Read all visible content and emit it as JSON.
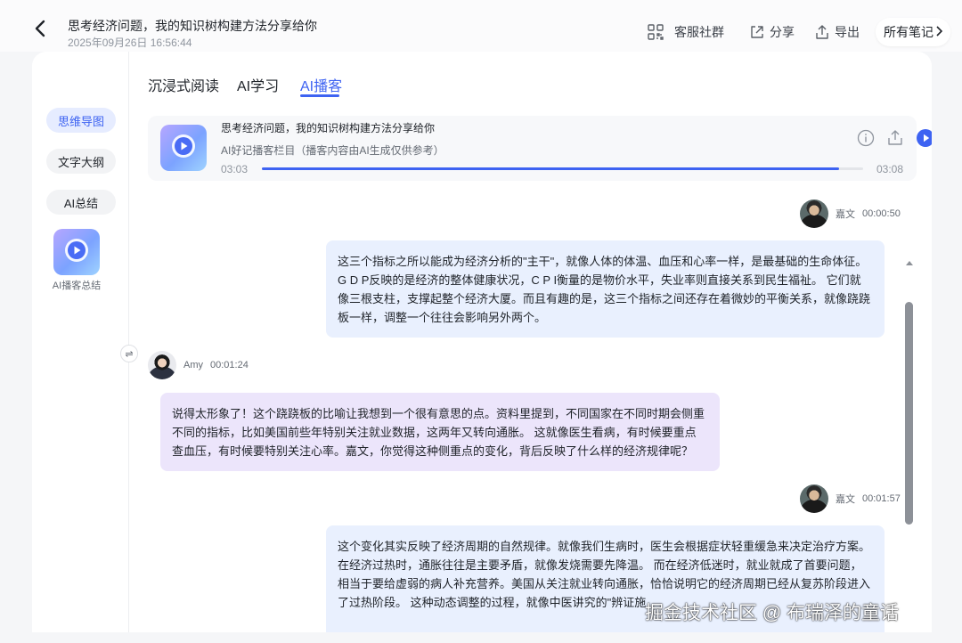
{
  "header": {
    "title": "思考经济问题，我的知识树构建方法分享给你",
    "datetime": "2025年09月26日 16:56:44",
    "community_label": "客服社群",
    "share_label": "分享",
    "export_label": "导出",
    "all_notes_label": "所有笔记"
  },
  "sidebar": {
    "items": [
      {
        "label": "思维导图",
        "active": true
      },
      {
        "label": "文字大纲",
        "active": false
      },
      {
        "label": "AI总结",
        "active": false
      }
    ],
    "podcast_summary_label": "AI播客总结"
  },
  "tabs": [
    {
      "label": "沉浸式阅读",
      "active": false
    },
    {
      "label": "AI学习",
      "active": false
    },
    {
      "label": "AI播客",
      "active": true
    }
  ],
  "player": {
    "title": "思考经济问题，我的知识树构建方法分享给你",
    "subtitle": "AI好记播客栏目（播客内容由AI生成仅供参考）",
    "current_time": "03:03",
    "total_time": "03:08",
    "progress": 0.96
  },
  "transcript": [
    {
      "speaker": "嘉文",
      "time": "00:00:50",
      "side": "right",
      "lines": [
        "这三个指标之所以能成为经济分析的\"主干\"，就像人体的体温、血压和心率一样，是最基础的生命体征。",
        "G D P反映的是经济的整体健康状况，C P I衡量的是物价水平，失业率则直接关系到民生福祉。 它们就",
        "像三根支柱，支撑起整个经济大厦。而且有趣的是，这三个指标之间还存在着微妙的平衡关系，就像跷跷",
        "板一样，调整一个往往会影响另外两个。"
      ]
    },
    {
      "speaker": "Amy",
      "time": "00:01:24",
      "side": "left",
      "lines": [
        "说得太形象了！这个跷跷板的比喻让我想到一个很有意思的点。资料里提到，不同国家在不同时期会侧重",
        "不同的指标，比如美国前些年特别关注就业数据，这两年又转向通胀。 这就像医生看病，有时候要重点",
        "查血压，有时候要特别关注心率。嘉文，你觉得这种侧重点的变化，背后反映了什么样的经济规律呢？"
      ]
    },
    {
      "speaker": "嘉文",
      "time": "00:01:57",
      "side": "right",
      "lines": [
        "这个变化其实反映了经济周期的自然规律。就像我们生病时，医生会根据症状轻重缓急来决定治疗方案。",
        "在经济过热时，通胀往往是主要矛盾，就像发烧需要先降温。 而在经济低迷时，就业就成了首要问题，",
        "相当于要给虚弱的病人补充营养。美国从关注就业转向通胀，恰恰说明它的经济周期已经从复苏阶段进入",
        "了过热阶段。 这种动态调整的过程，就像中医讲究的\"辨证施"
      ]
    }
  ],
  "watermark": "掘金技术社区 @ 布瑞泽的童话",
  "colors": {
    "accent": "#3e63f2",
    "bubble_right": "#e9f0fe",
    "bubble_left": "#ece5fb"
  }
}
